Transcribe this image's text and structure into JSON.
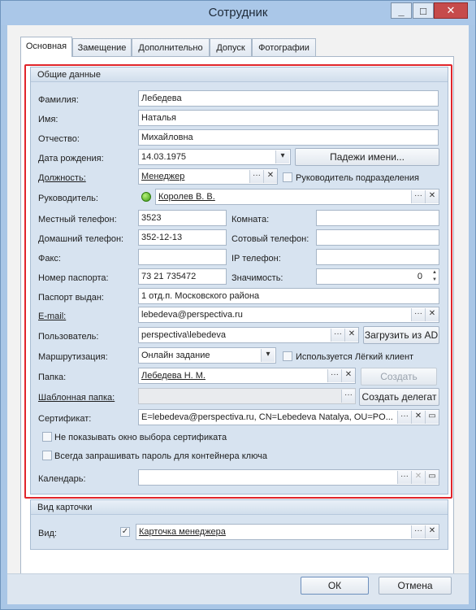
{
  "window": {
    "title": "Сотрудник",
    "minimize_icon": "minimize-icon",
    "maximize_icon": "maximize-icon",
    "close_icon": "close-icon"
  },
  "tabs": [
    {
      "label": "Основная",
      "active": true
    },
    {
      "label": "Замещение",
      "active": false
    },
    {
      "label": "Дополнительно",
      "active": false
    },
    {
      "label": "Допуск",
      "active": false
    },
    {
      "label": "Фотографии",
      "active": false
    }
  ],
  "general": {
    "title": "Общие данные",
    "surname": {
      "label": "Фамилия:",
      "value": "Лебедева"
    },
    "name": {
      "label": "Имя:",
      "value": "Наталья"
    },
    "patronymic": {
      "label": "Отчество:",
      "value": "Михайловна"
    },
    "birth": {
      "label": "Дата рождения:",
      "value": "14.03.1975"
    },
    "cases_button": "Падежи имени...",
    "position": {
      "label": "Должность:",
      "value": "Менеджер"
    },
    "head_of_dept": {
      "label": "Руководитель подразделения",
      "checked": false
    },
    "manager": {
      "label": "Руководитель:",
      "value": "Королев В. В."
    },
    "local_phone": {
      "label": "Местный телефон:",
      "value": "3523"
    },
    "room": {
      "label": "Комната:",
      "value": ""
    },
    "home_phone": {
      "label": "Домашний телефон:",
      "value": "352-12-13"
    },
    "mobile_phone": {
      "label": "Сотовый телефон:",
      "value": ""
    },
    "fax": {
      "label": "Факс:",
      "value": ""
    },
    "ip_phone": {
      "label": "IP телефон:",
      "value": ""
    },
    "passport": {
      "label": "Номер паспорта:",
      "value": "73 21 735472"
    },
    "importance": {
      "label": "Значимость:",
      "value": "0"
    },
    "passport_issued": {
      "label": "Паспорт выдан:",
      "value": "1 отд.п. Московского района"
    },
    "email": {
      "label": "E-mail:",
      "value": "lebedeva@perspectiva.ru"
    },
    "user": {
      "label": "Пользователь:",
      "value": "perspectiva\\lebedeva"
    },
    "load_ad_button": "Загрузить из AD",
    "routing": {
      "label": "Маршрутизация:",
      "value": "Онлайн задание"
    },
    "light_client": {
      "label": "Используется Лёгкий клиент",
      "checked": false
    },
    "folder": {
      "label": "Папка:",
      "value": "Лебедева Н. М."
    },
    "create_button": "Создать",
    "template_folder": {
      "label": "Шаблонная папка:",
      "value": ""
    },
    "create_delegate_button": "Создать делегат",
    "certificate": {
      "label": "Сертификат:",
      "value": "E=lebedeva@perspectiva.ru, CN=Lebedeva Natalya, OU=PO..."
    },
    "no_cert_window": {
      "label": "Не показывать окно выбора сертификата",
      "checked": false
    },
    "always_ask_password": {
      "label": "Всегда запрашивать пароль для контейнера ключа",
      "checked": false
    },
    "calendar": {
      "label": "Календарь:",
      "value": ""
    }
  },
  "card_view": {
    "title": "Вид карточки",
    "view": {
      "label": "Вид:",
      "value": "Карточка менеджера",
      "checked": true
    }
  },
  "buttons": {
    "ok": "ОК",
    "cancel": "Отмена"
  },
  "glyphs": {
    "ellipsis": "···",
    "clear": "✕",
    "dropdown": "▾",
    "check": "✓",
    "spin_up": "▲",
    "spin_down": "▼",
    "cert": "▭"
  },
  "colors": {
    "highlight": "#e0252b",
    "window_frame": "#a9c6e6",
    "group_bg": "#d7e3f0"
  }
}
